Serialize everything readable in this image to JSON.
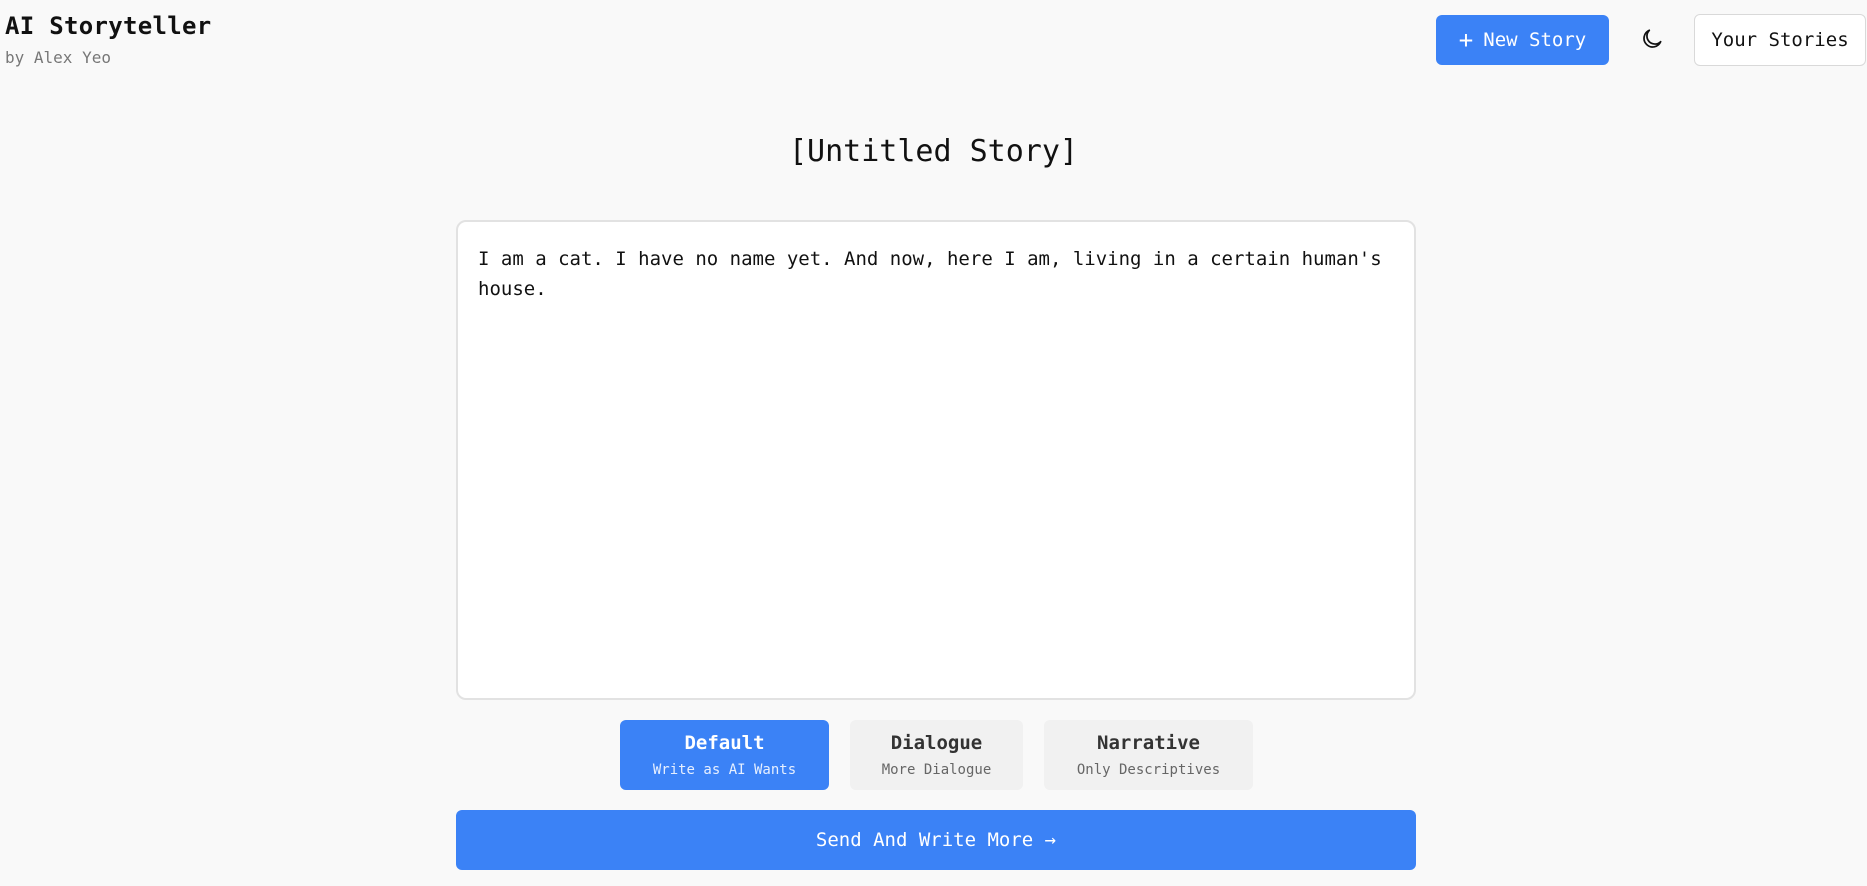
{
  "app": {
    "title": "AI Storyteller",
    "author": "by Alex Yeo"
  },
  "toolbar": {
    "new_story_label": "New Story",
    "your_stories_label": "Your Stories",
    "theme_icon": "moon-icon"
  },
  "story": {
    "title": "[Untitled Story]",
    "text": "I am a cat. I have no name yet. And now, here I am, living in a certain human's house."
  },
  "modes": [
    {
      "title": "Default",
      "subtitle": "Write as AI Wants",
      "active": true
    },
    {
      "title": "Dialogue",
      "subtitle": "More Dialogue",
      "active": false
    },
    {
      "title": "Narrative",
      "subtitle": "Only Descriptives",
      "active": false
    }
  ],
  "actions": {
    "send_label": "Send And Write More →"
  },
  "colors": {
    "accent": "#3b82f6",
    "background": "#f9f9f9"
  }
}
